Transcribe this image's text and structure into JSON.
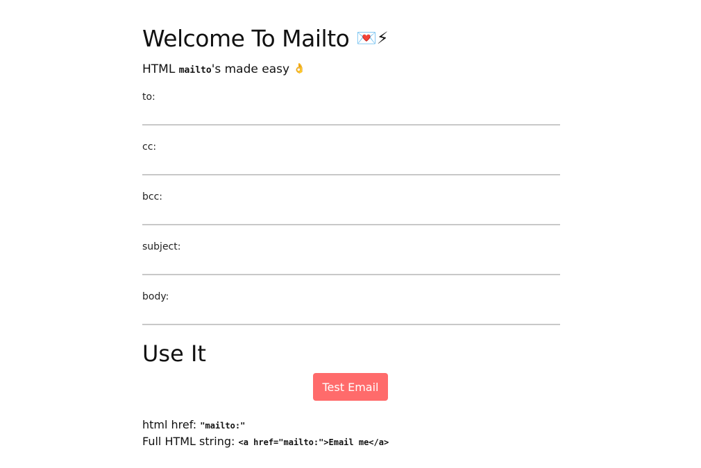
{
  "header": {
    "title": "Welcome To Mailto",
    "title_emoji": "💌⚡",
    "tagline_prefix": "HTML",
    "tagline_code": "mailto",
    "tagline_suffix": "'s made easy",
    "tagline_emoji": "👌"
  },
  "form": {
    "fields": [
      {
        "label": "to:",
        "value": ""
      },
      {
        "label": "cc:",
        "value": ""
      },
      {
        "label": "bcc:",
        "value": ""
      },
      {
        "label": "subject:",
        "value": ""
      },
      {
        "label": "body:",
        "value": ""
      }
    ]
  },
  "use_it": {
    "heading": "Use It",
    "button_label": "Test Email",
    "href_label": "html href:",
    "href_value": "\"mailto:\"",
    "full_label": "Full HTML string:",
    "full_value": "<a href=\"mailto:\">Email me</a>"
  },
  "colors": {
    "button_bg": "#ff6b6b",
    "input_border": "#c8c8c8"
  }
}
